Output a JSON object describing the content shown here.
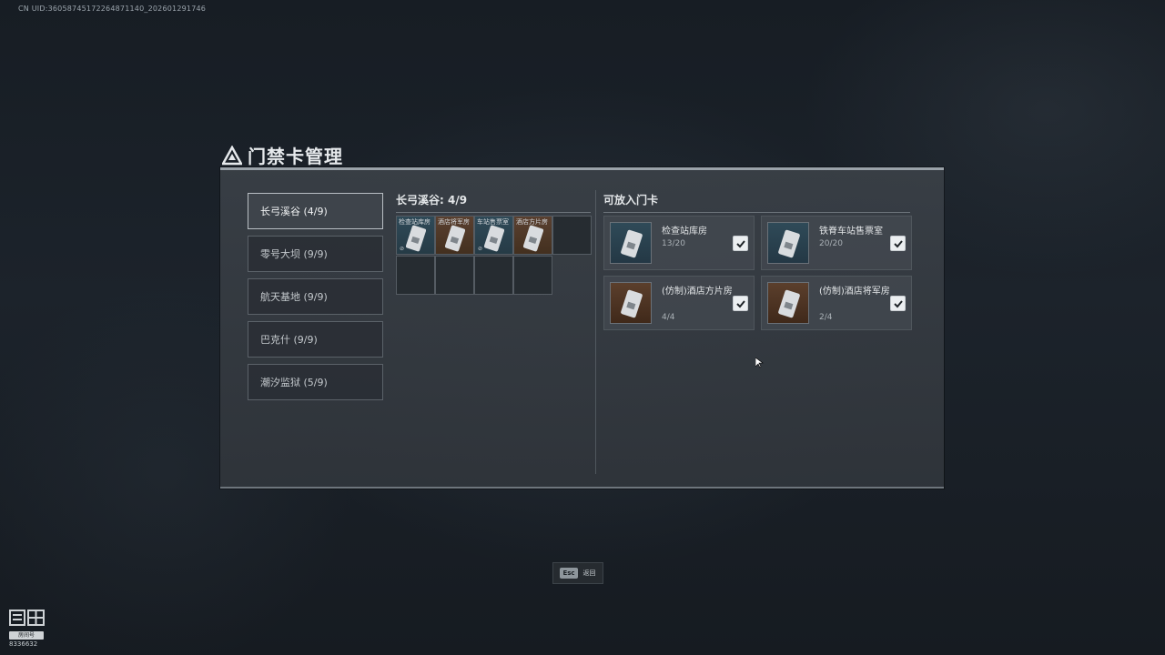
{
  "uid_text": "CN UID:360587451722648711­40_202601291746",
  "title": "门禁卡管理",
  "zones": [
    {
      "label": "长弓溪谷 (4/9)",
      "active": true
    },
    {
      "label": "零号大坝 (9/9)",
      "active": false
    },
    {
      "label": "航天基地 (9/9)",
      "active": false
    },
    {
      "label": "巴克什 (9/9)",
      "active": false
    },
    {
      "label": "潮汐监狱 (5/9)",
      "active": false
    }
  ],
  "slots_header": "长弓溪谷: 4/9",
  "slots": [
    {
      "label": "检查站库房",
      "color": "blue"
    },
    {
      "label": "酒店将军房",
      "color": "brown"
    },
    {
      "label": "车站售票室",
      "color": "blue"
    },
    {
      "label": "酒店方片房",
      "color": "brown"
    }
  ],
  "available_header": "可放入门卡",
  "cards": [
    {
      "name": "检查站库房",
      "count": "13/20",
      "color": "blue",
      "checked": true
    },
    {
      "name": "铁脊车站售票室",
      "count": "20/20",
      "color": "blue",
      "checked": true
    },
    {
      "name": "(仿制)酒店方片房",
      "count": "4/4",
      "color": "brown",
      "checked": true
    },
    {
      "name": "(仿制)酒店将军房",
      "count": "2/4",
      "color": "brown",
      "checked": true
    }
  ],
  "esc": {
    "key": "Esc",
    "label": "返回"
  },
  "watermark": {
    "logo": "斗鱼",
    "tag": "房间号",
    "id": "8336632"
  },
  "colors": {
    "panel": "#353a40",
    "accent_border": "#9aa2a9",
    "blue_slot": "#2f4a58",
    "brown_slot": "#5a4030"
  }
}
